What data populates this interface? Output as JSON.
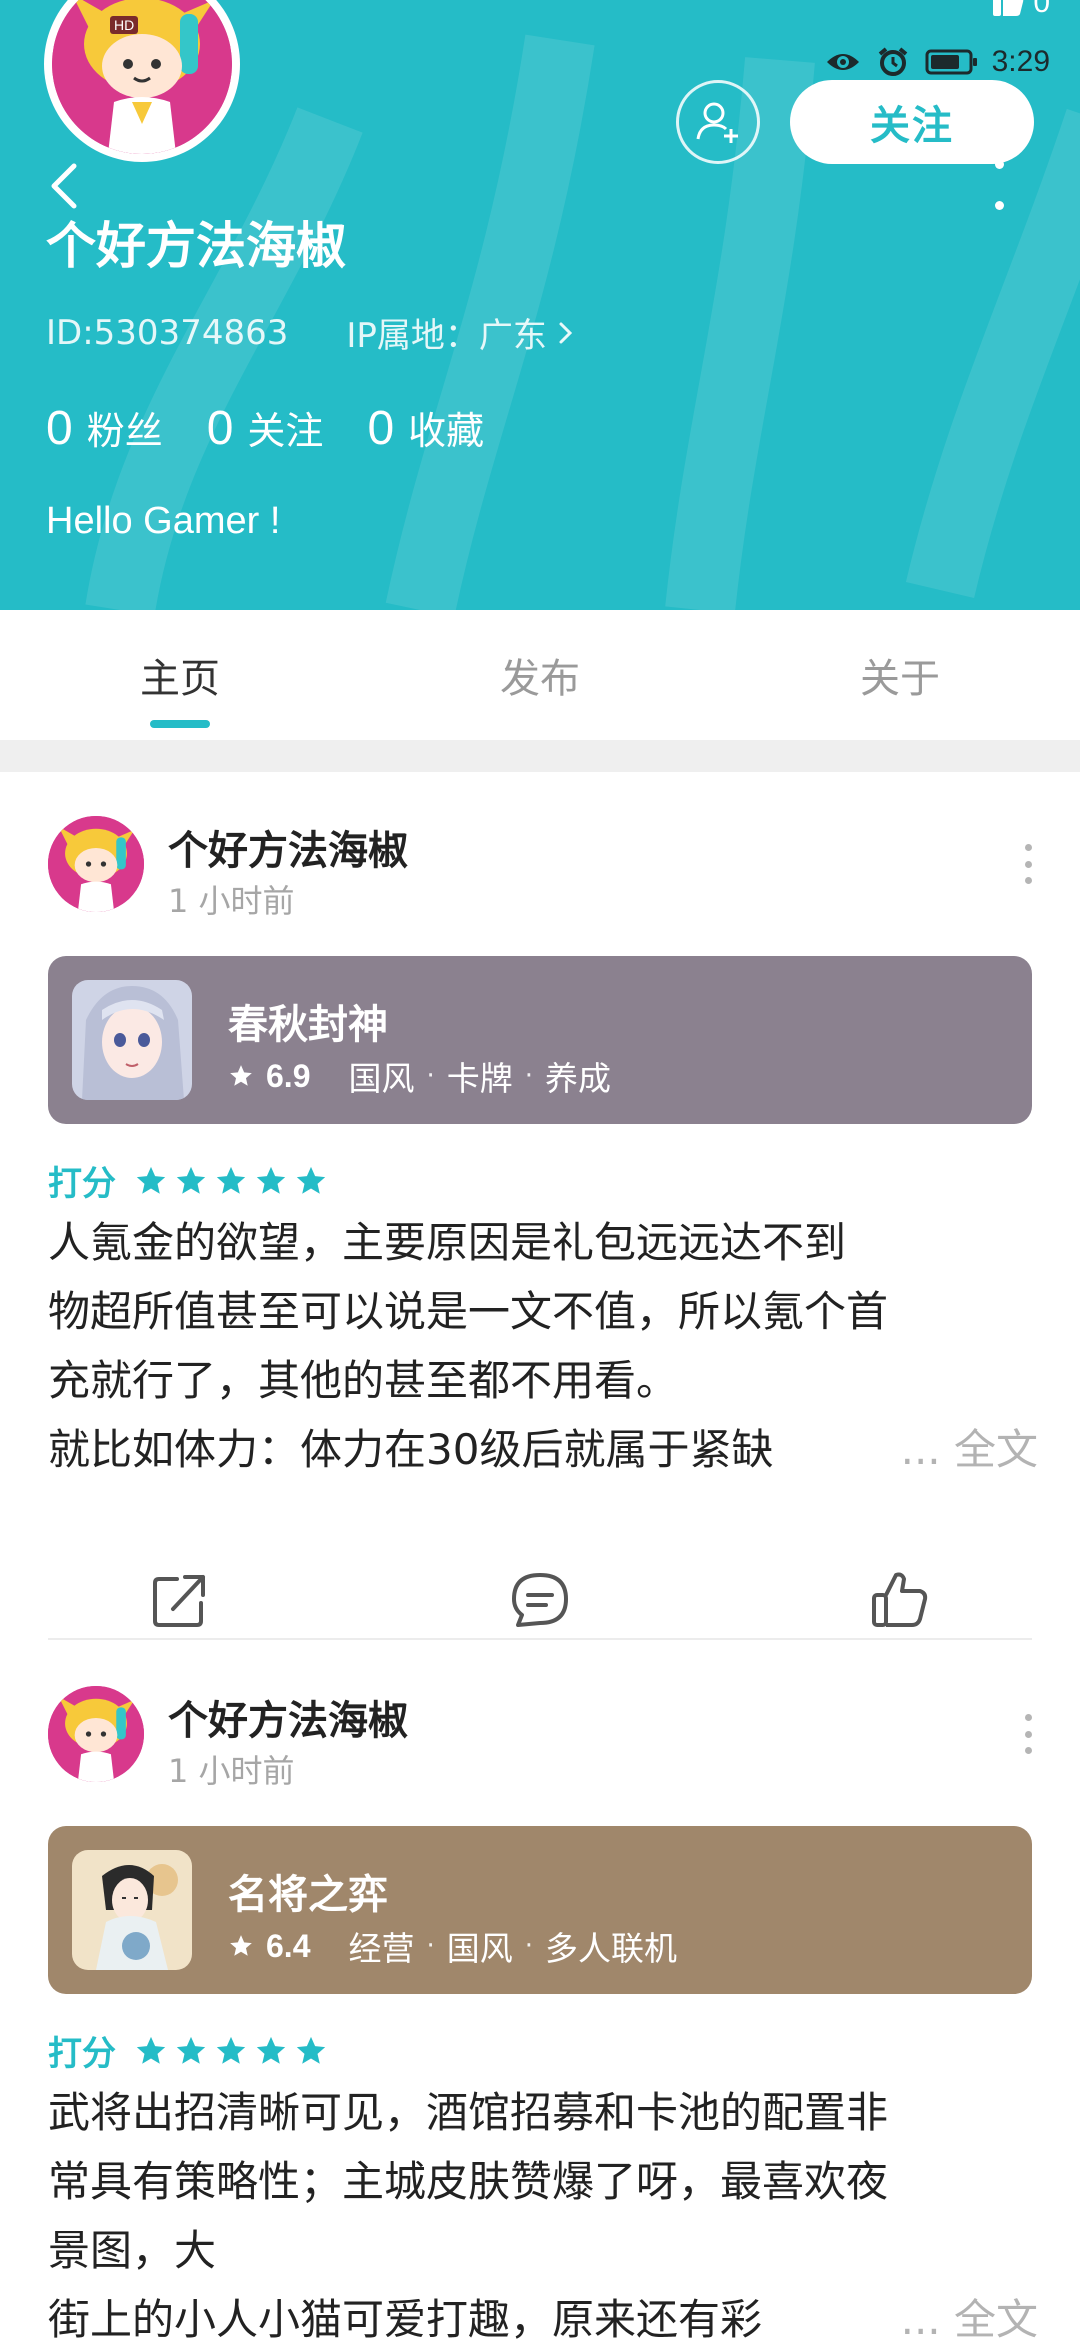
{
  "status_bar": {
    "time": "3:29",
    "network_label": "HD",
    "corner_count": "0"
  },
  "profile": {
    "username": "个好方法海椒",
    "id_text": "ID:530374863",
    "ip_text": "IP属地：广东",
    "follow_label": "关注",
    "bio": "Hello Gamer !",
    "stats": [
      {
        "num": "0",
        "label": "粉丝"
      },
      {
        "num": "0",
        "label": "关注"
      },
      {
        "num": "0",
        "label": "收藏"
      }
    ]
  },
  "tabs": [
    {
      "label": "主页",
      "active": true
    },
    {
      "label": "发布",
      "active": false
    },
    {
      "label": "关于",
      "active": false
    }
  ],
  "posts": [
    {
      "author": "个好方法海椒",
      "time": "1 小时前",
      "game": {
        "name": "春秋封神",
        "score": "6.9",
        "tags": [
          "国风",
          "卡牌",
          "养成"
        ],
        "card_color": "#8b818f"
      },
      "rating_label": "打分",
      "stars": 5,
      "lines": [
        "人氪金的欲望，主要原因是礼包远远达不到",
        "物超所值甚至可以说是一文不值，所以氪个首",
        "充就行了，其他的甚至都不用看。",
        "就比如体力：体力在30级后就属于紧缺"
      ],
      "more_label": "... 全文"
    },
    {
      "author": "个好方法海椒",
      "time": "1 小时前",
      "game": {
        "name": "名将之弈",
        "score": "6.4",
        "tags": [
          "经营",
          "国风",
          "多人联机"
        ],
        "card_color": "#a0876b"
      },
      "rating_label": "打分",
      "stars": 5,
      "lines": [
        "武将出招清晰可见，酒馆招募和卡池的配置非",
        "常具有策略性；主城皮肤赞爆了呀，最喜欢夜",
        "景图，大",
        "街上的小人小猫可爱打趣，原来还有彩"
      ],
      "more_label": "... 全文"
    }
  ],
  "colors": {
    "accent": "#25bcc7",
    "header_bg": "#25bcc7"
  }
}
